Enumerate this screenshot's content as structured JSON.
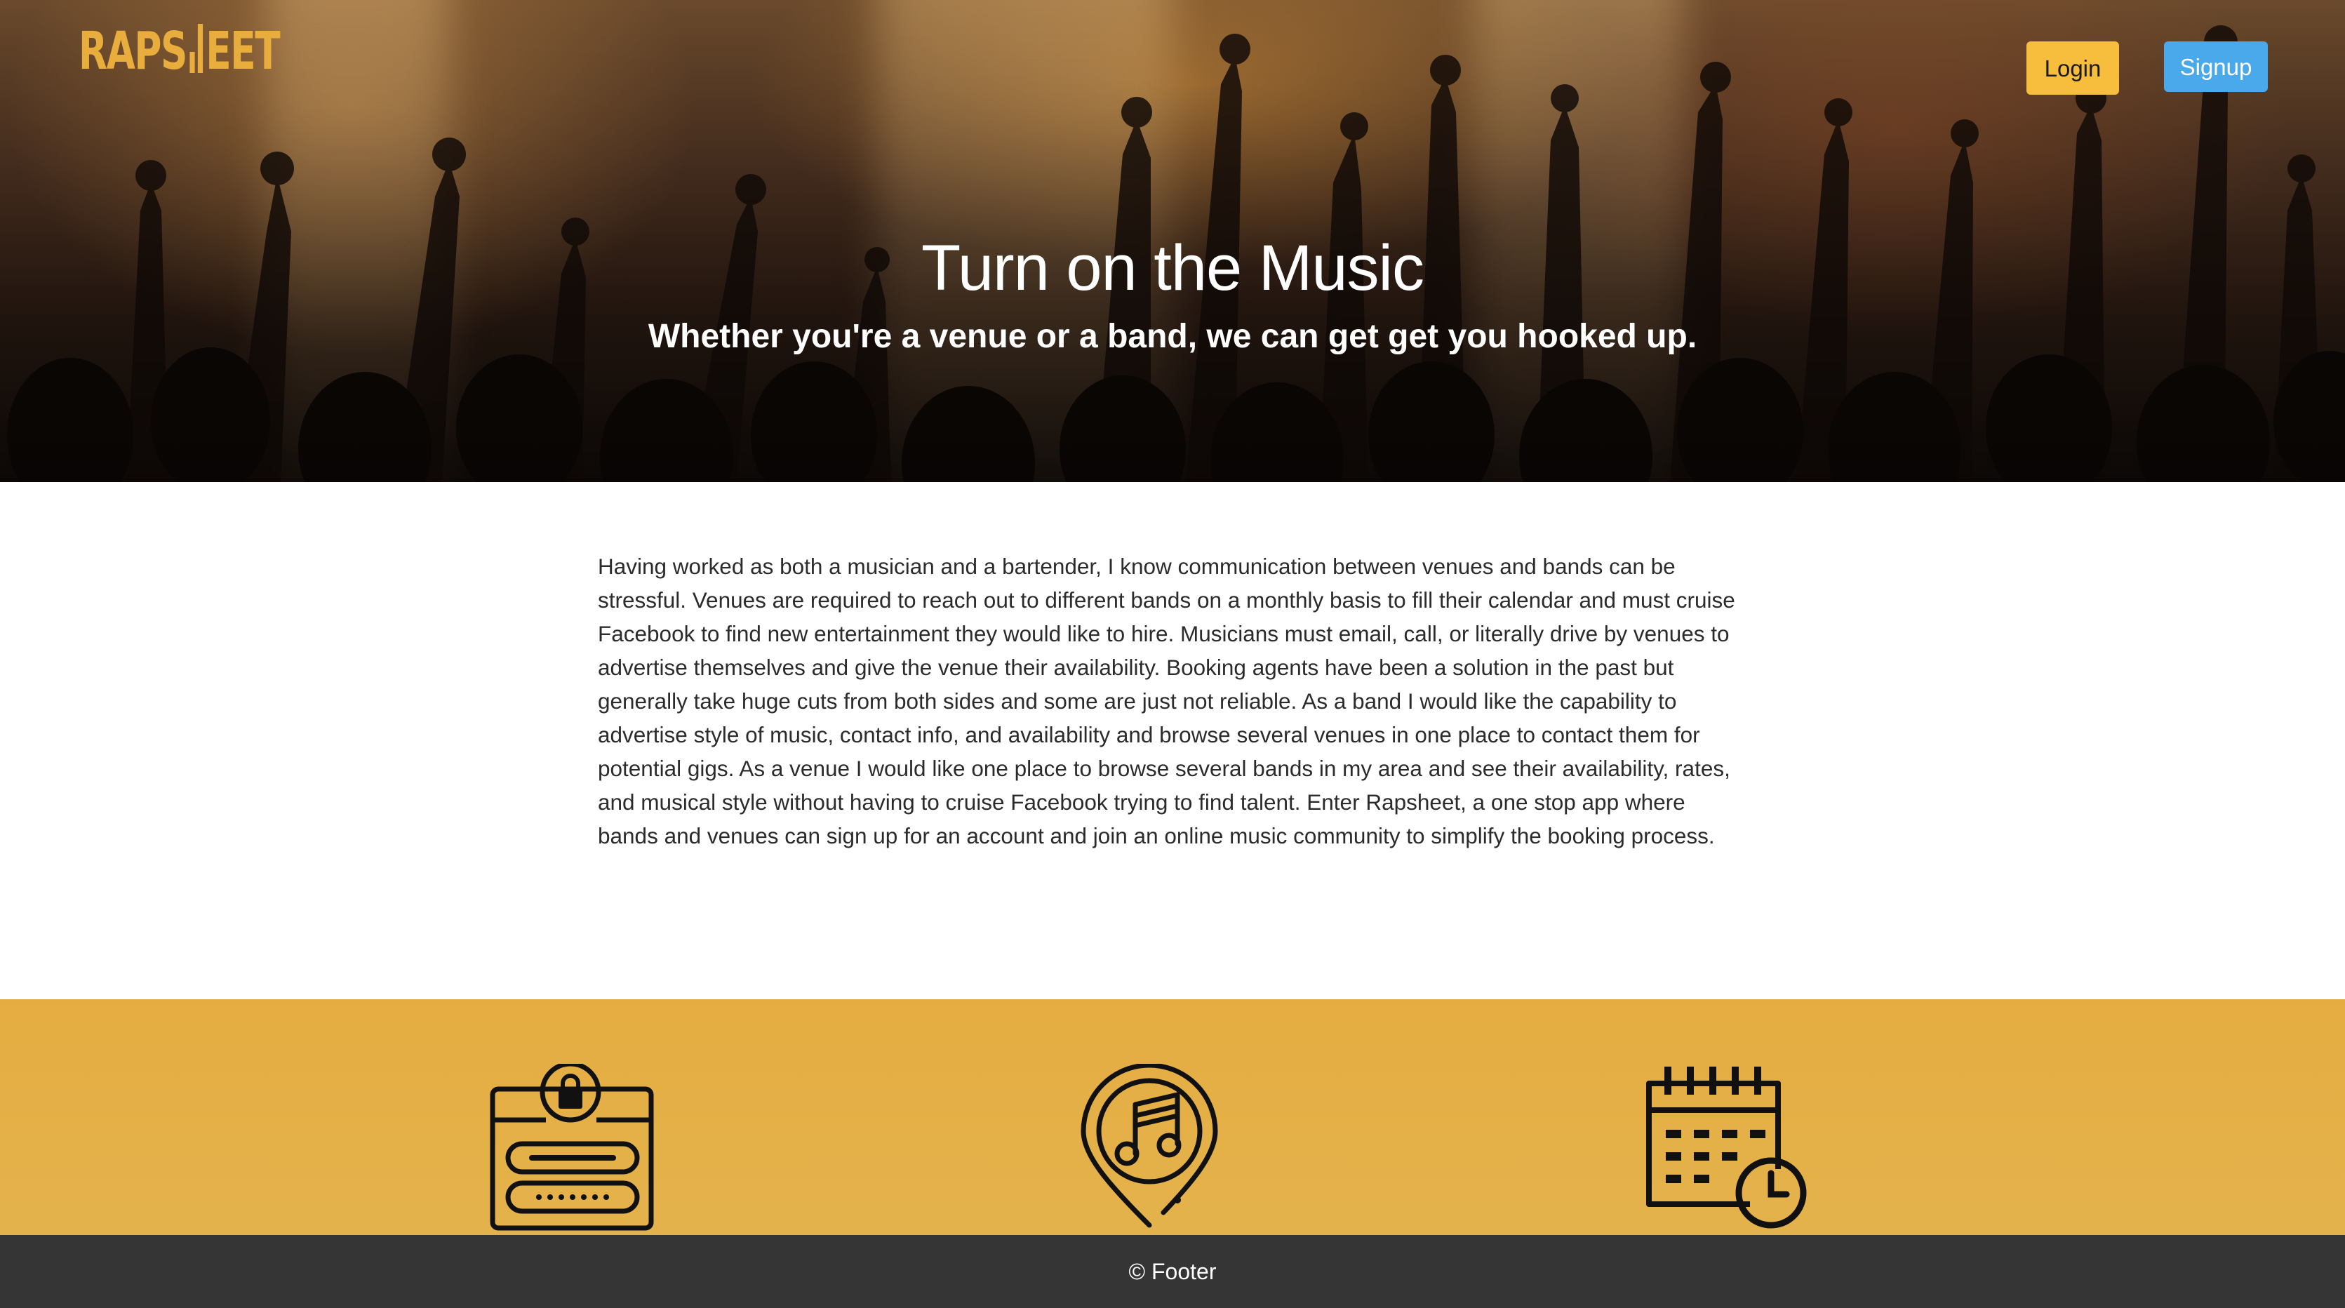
{
  "header": {
    "logo_text_left": "RAPS",
    "logo_text_right": "EET",
    "login_label": "Login",
    "signup_label": "Signup"
  },
  "hero": {
    "title": "Turn on the Music",
    "subtitle": "Whether you're a venue or a band, we can get get you hooked up."
  },
  "about": {
    "text": "Having worked as both a musician and a bartender, I know communication between venues and bands can be stressful. Venues are required to reach out to different bands on a monthly basis to fill their calendar and must cruise Facebook to find new entertainment they would like to hire. Musicians must email, call, or literally drive by venues to advertise themselves and give the venue their availability. Booking agents have been a solution in the past but generally take huge cuts from both sides and some are just not reliable. As a band I would like the capability to advertise style of music, contact info, and availability and browse several venues in one place to contact them for potential gigs. As a venue I would like one place to browse several bands in my area and see their availability, rates, and musical style without having to cruise Facebook trying to find talent. Enter Rapsheet, a one stop app where bands and venues can sign up for an account and join an online music community to simplify the booking process."
  },
  "features": {
    "icons": [
      "secure-login-icon",
      "music-location-icon",
      "calendar-schedule-icon"
    ]
  },
  "footer": {
    "text": "© Footer"
  },
  "colors": {
    "brand_gold": "#e8ad3d",
    "login_button": "#f7bd3c",
    "signup_button": "#4aa9ea",
    "features_band": "#e5ad41",
    "footer_bg": "#353535"
  }
}
